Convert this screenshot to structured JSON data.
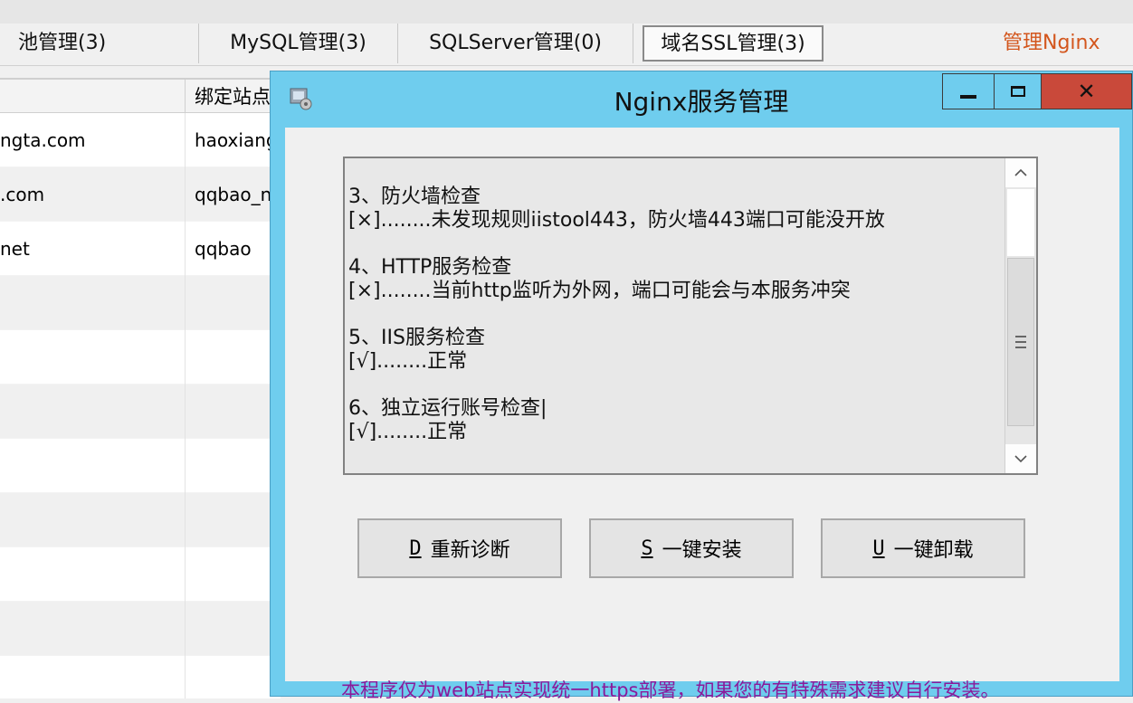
{
  "tabs": [
    {
      "label": "池管理(3)"
    },
    {
      "label": "MySQL管理(3)"
    },
    {
      "label": "SQLServer管理(0)"
    },
    {
      "label": "域名SSL管理(3)"
    },
    {
      "label": "管理Nginx"
    }
  ],
  "table": {
    "col2_header": "绑定站点",
    "rows": [
      {
        "c1": "ngta.com",
        "c2": "haoxiang"
      },
      {
        "c1": ".com",
        "c2": "qqbao_n"
      },
      {
        "c1": "net",
        "c2": "qqbao"
      }
    ]
  },
  "dialog": {
    "title": "Nginx服务管理",
    "log": [
      {
        "heading": "3、防火墙检查",
        "result": "[×]........未发现规则iistool443，防火墙443端口可能没开放"
      },
      {
        "heading": "4、HTTP服务检查",
        "result": "[×]........当前http监听为外网，端口可能会与本服务冲突"
      },
      {
        "heading": "5、IIS服务检查",
        "result": "[√]........正常"
      },
      {
        "heading": "6、独立运行账号检查|",
        "result": "[√]........正常"
      }
    ],
    "buttons": {
      "diagnose_key": "D",
      "diagnose_label": "重新诊断",
      "install_key": "S",
      "install_label": "一键安装",
      "uninstall_key": "U",
      "uninstall_label": "一键卸载"
    },
    "note": "本程序仅为web站点实现统一https部署，如果您的有特殊需求建议自行安装。"
  }
}
